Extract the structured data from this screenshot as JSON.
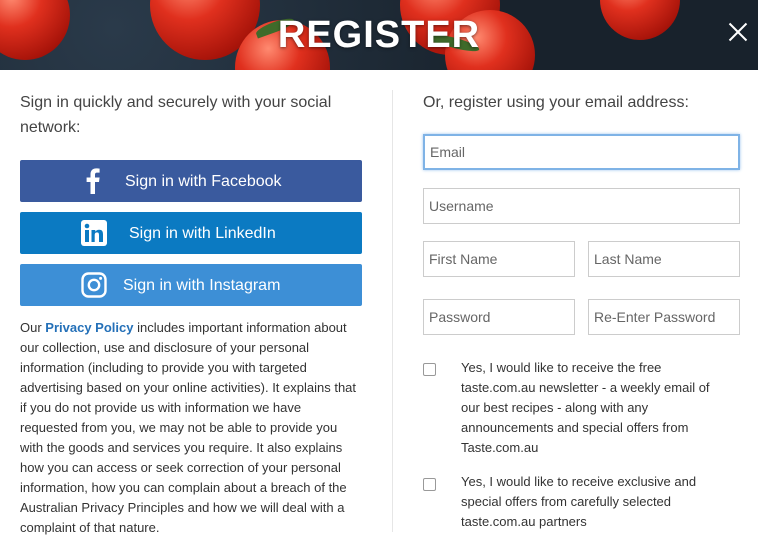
{
  "header": {
    "title": "REGISTER",
    "close_icon": "close-icon"
  },
  "social": {
    "lead": "Sign in quickly and securely with your social network:",
    "facebook": {
      "label": "Sign in with Facebook",
      "icon": "facebook-icon",
      "color": "#3a5a9e"
    },
    "linkedin": {
      "label": "Sign in with LinkedIn",
      "icon": "linkedin-icon",
      "color": "#0b7ac2"
    },
    "instagram": {
      "label": "Sign in with Instagram",
      "icon": "instagram-icon",
      "color": "#3d8fd6"
    }
  },
  "policy": {
    "prefix": "Our ",
    "link": "Privacy Policy",
    "body": " includes important information about our collection, use and disclosure of your personal information (including to provide you with targeted advertising based on your online activities). It explains that if you do not provide us with information we have requested from you, we may not be able to provide you with the goods and services you require. It also explains how you can access or seek correction of your personal information, how you can complain about a breach of the Australian Privacy Principles and how we will deal with a complaint of that nature."
  },
  "register": {
    "lead": "Or, register using your email address:",
    "email_placeholder": "Email",
    "username_placeholder": "Username",
    "first_name_placeholder": "First Name",
    "last_name_placeholder": "Last Name",
    "password_placeholder": "Password",
    "reenter_password_placeholder": "Re-Enter Password",
    "newsletter_text": "Yes, I would like to receive the free taste.com.au newsletter - a weekly email of our best recipes - along with any announcements and special offers from Taste.com.au",
    "offers_text": "Yes, I would like to receive exclusive and special offers from carefully selected taste.com.au partners"
  }
}
